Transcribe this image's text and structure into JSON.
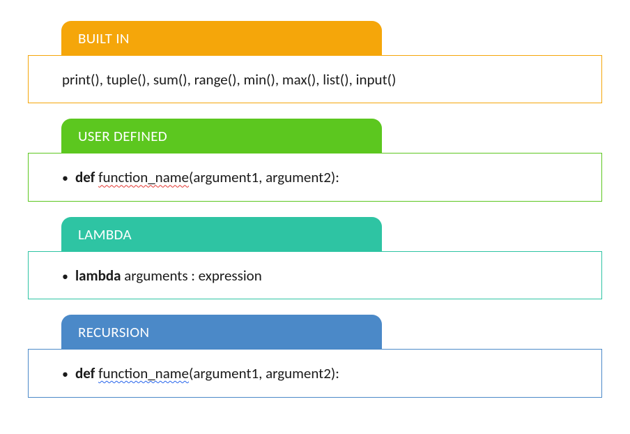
{
  "blocks": [
    {
      "title": "BUILT IN",
      "color": "#f5a60a",
      "has_bullet": false,
      "content_plain": "print(), tuple(), sum(), range(), min(), max(), list(), input()",
      "parts": [
        {
          "text": "print(), tuple(), sum(), range(), min(), max(), list(), input()"
        }
      ]
    },
    {
      "title": "USER DEFINED",
      "color": "#5cc71f",
      "has_bullet": true,
      "content_plain": "def function_name(argument1, argument2):",
      "parts": [
        {
          "text": "def",
          "bold": true
        },
        {
          "text": " "
        },
        {
          "text": "function_name",
          "squiggle": "red"
        },
        {
          "text": "(argument1, argument2):"
        }
      ]
    },
    {
      "title": "LAMBDA",
      "color": "#2ec4a3",
      "has_bullet": true,
      "content_plain": "lambda arguments : expression",
      "parts": [
        {
          "text": "lambda",
          "bold": true
        },
        {
          "text": " arguments : expression"
        }
      ]
    },
    {
      "title": "RECURSION",
      "color": "#4b89c8",
      "has_bullet": true,
      "content_plain": "def function_name(argument1, argument2):",
      "parts": [
        {
          "text": "def",
          "bold": true
        },
        {
          "text": " "
        },
        {
          "text": "function_name",
          "squiggle": "blue"
        },
        {
          "text": "(argument1, argument2):"
        }
      ]
    }
  ]
}
